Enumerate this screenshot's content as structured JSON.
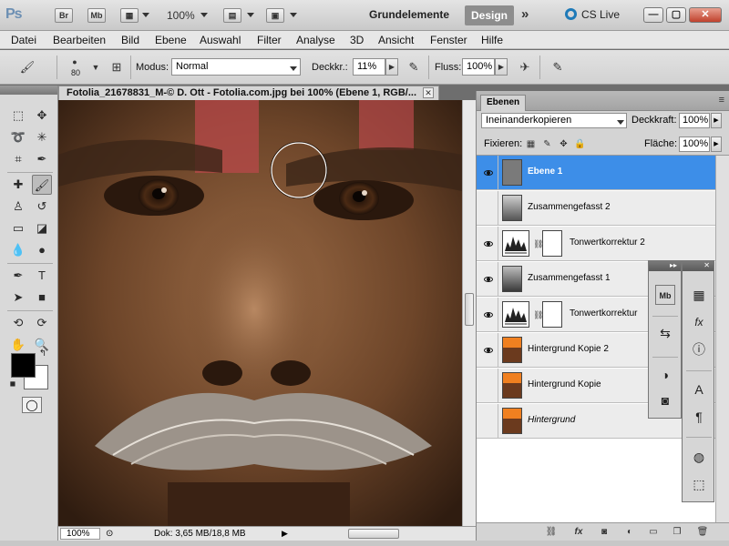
{
  "app": {
    "logo": "Ps",
    "bridge_label": "Br",
    "minibridge_label": "Mb",
    "zoom": "100%",
    "workspace_basic": "Grundelemente",
    "workspace_active": "Design",
    "more": "»",
    "cs_live": "CS Live",
    "window_buttons": [
      "—",
      "▢",
      "✕"
    ]
  },
  "menu": [
    "Datei",
    "Bearbeiten",
    "Bild",
    "Ebene",
    "Auswahl",
    "Filter",
    "Analyse",
    "3D",
    "Ansicht",
    "Fenster",
    "Hilfe"
  ],
  "options": {
    "brush_size": "80",
    "mode_label": "Modus:",
    "mode_value": "Normal",
    "opacity_label": "Deckkr.:",
    "opacity_value": "11%",
    "flow_label": "Fluss:",
    "flow_value": "100%"
  },
  "document": {
    "tab_title": "Fotolia_21678831_M-© D. Ott - Fotolia.com.jpg bei 100% (Ebene 1, RGB/...",
    "close": "✕",
    "zoom": "100%",
    "doc_info": "Dok: 3,65 MB/18,8 MB",
    "status_arrow": "▶"
  },
  "layers_panel": {
    "tab": "Ebenen",
    "blend_mode": "Ineinanderkopieren",
    "opacity_label": "Deckkraft:",
    "opacity_value": "100%",
    "lock_label": "Fixieren:",
    "fill_label": "Fläche:",
    "fill_value": "100%",
    "layers": [
      {
        "name": "Ebene 1",
        "visible": true,
        "selected": true,
        "kind": "pixel"
      },
      {
        "name": "Zusammengefasst 2",
        "visible": false,
        "selected": false,
        "kind": "pixel"
      },
      {
        "name": "Tonwertkorrektur 2",
        "visible": true,
        "selected": false,
        "kind": "adjustment"
      },
      {
        "name": "Zusammengefasst 1",
        "visible": true,
        "selected": false,
        "kind": "pixel"
      },
      {
        "name": "Tonwertkorrektur",
        "visible": true,
        "selected": false,
        "kind": "adjustment"
      },
      {
        "name": "Hintergrund Kopie 2",
        "visible": true,
        "selected": false,
        "kind": "pixel"
      },
      {
        "name": "Hintergrund Kopie",
        "visible": false,
        "selected": false,
        "kind": "pixel"
      },
      {
        "name": "Hintergrund",
        "visible": false,
        "selected": false,
        "kind": "pixel"
      }
    ]
  },
  "colors": {
    "accent_selected": "#3d8ee8",
    "foreground": "#000000",
    "background": "#ffffff",
    "workspace_active_bg": "#8d8d8d"
  }
}
